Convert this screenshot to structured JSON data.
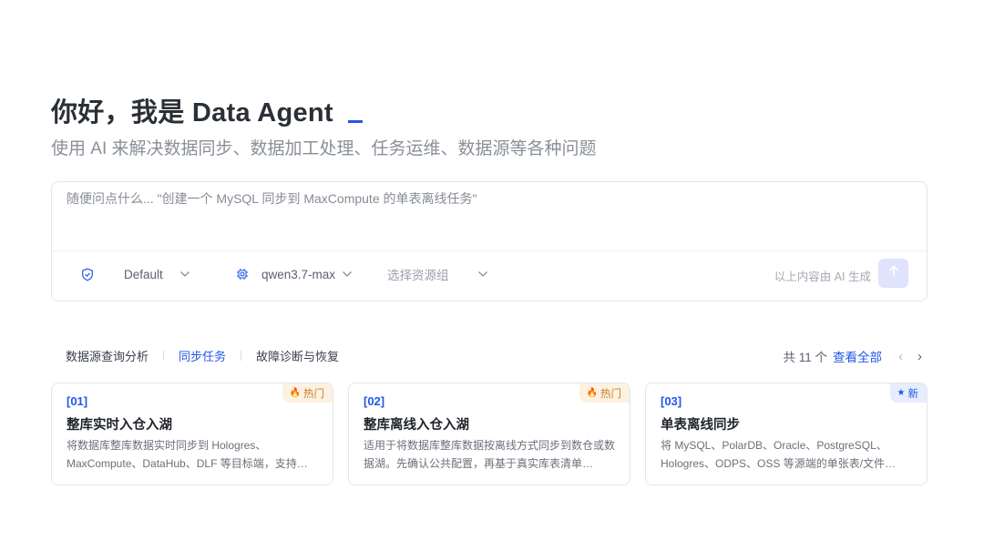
{
  "hero": {
    "title": "你好，我是 Data Agent",
    "subtitle": "使用 AI 来解决数据同步、数据加工处理、任务运维、数据源等各种问题"
  },
  "composer": {
    "placeholder": "随便问点什么... \"创建一个 MySQL 同步到 MaxCompute 的单表离线任务\"",
    "mode": "Default",
    "model": "qwen3.7-max",
    "resource_group_placeholder": "选择资源组",
    "ai_note": "以上内容由 AI 生成"
  },
  "tabs": [
    {
      "label": "数据源查询分析",
      "active": false
    },
    {
      "label": "同步任务",
      "active": true
    },
    {
      "label": "故障诊断与恢复",
      "active": false
    }
  ],
  "pager": {
    "count_text": "共 11 个",
    "view_all": "查看全部",
    "prev": "‹",
    "next": "›"
  },
  "cards": [
    {
      "num": "[01]",
      "title": "整库实时入仓入湖",
      "desc": "将数据库整库数据实时同步到 Hologres、MaxCompute、DataHub、DLF 等目标端，支持…",
      "badge": "热门",
      "badge_type": "hot"
    },
    {
      "num": "[02]",
      "title": "整库离线入仓入湖",
      "desc": "适用于将数据库整库数据按离线方式同步到数仓或数据湖。先确认公共配置，再基于真实库表清单…",
      "badge": "热门",
      "badge_type": "hot"
    },
    {
      "num": "[03]",
      "title": "单表离线同步",
      "desc": "将 MySQL、PolarDB、Oracle、PostgreSQL、Hologres、ODPS、OSS 等源端的单张表/文件…",
      "badge": "新",
      "badge_type": "new"
    }
  ],
  "colors": {
    "accent": "#2456e8",
    "hot": "#c4802a",
    "send_disabled": "#dfe3fb"
  },
  "icons": {
    "mode": "shield-check-icon",
    "model": "chip-icon",
    "hot": "flame-icon",
    "new": "star-icon",
    "send": "arrow-up-icon"
  }
}
